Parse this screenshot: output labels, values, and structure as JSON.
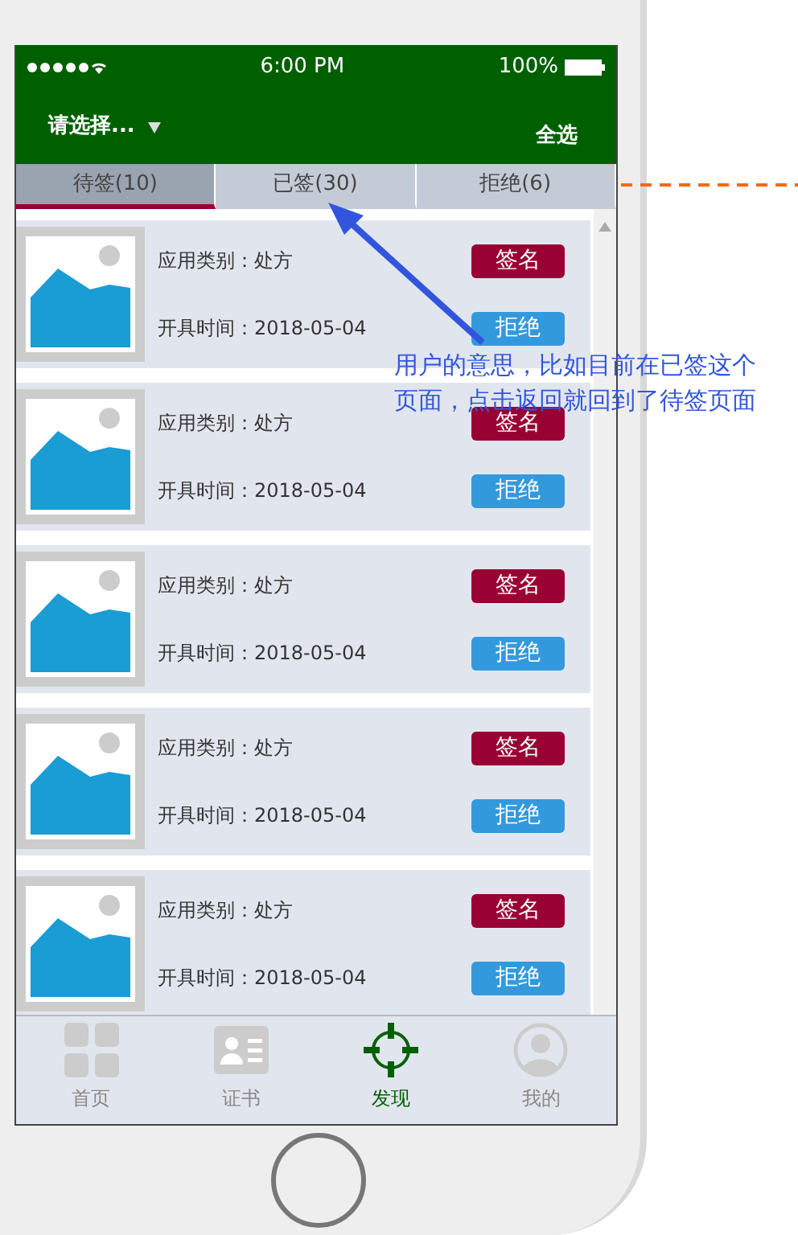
{
  "status_bar": {
    "time": "6:00 PM",
    "battery": "100%"
  },
  "header": {
    "select": "请选择...",
    "action": "全选"
  },
  "tabs": [
    {
      "label": "待签(10)",
      "selected": true
    },
    {
      "label": "已签(30)",
      "selected": false
    },
    {
      "label": "拒绝(6)",
      "selected": false
    }
  ],
  "items": [
    {
      "category": "应用类别：处方",
      "date": "开具时间：2018-05-04",
      "sign": "签名",
      "reject": "拒绝",
      "kind": "picture"
    },
    {
      "category": "应用类别：处方",
      "date": "开具时间：2018-05-04",
      "sign": "签名",
      "reject": "拒绝",
      "kind": "picture"
    },
    {
      "category": "应用类别：处方",
      "date": "开具时间：2018-05-04",
      "sign": "签名",
      "reject": "拒绝",
      "kind": "picture"
    },
    {
      "category": "应用类别：处方",
      "date": "开具时间：2018-05-04",
      "sign": "签名",
      "reject": "拒绝",
      "kind": "picture"
    },
    {
      "category": "应用类别：处方",
      "date": "开具时间：2018-05-04",
      "sign": "签名",
      "reject": "拒绝",
      "kind": "picture"
    }
  ],
  "bottom_nav": [
    {
      "label": "首页",
      "kind": "grid",
      "selected": false
    },
    {
      "label": "证书",
      "kind": "card",
      "selected": false
    },
    {
      "label": "发现",
      "kind": "target",
      "selected": true
    },
    {
      "label": "我的",
      "kind": "user",
      "selected": false
    }
  ],
  "annotation": "用户的意思，比如目前在已签这个页面，点击返回就回到了待签页面"
}
